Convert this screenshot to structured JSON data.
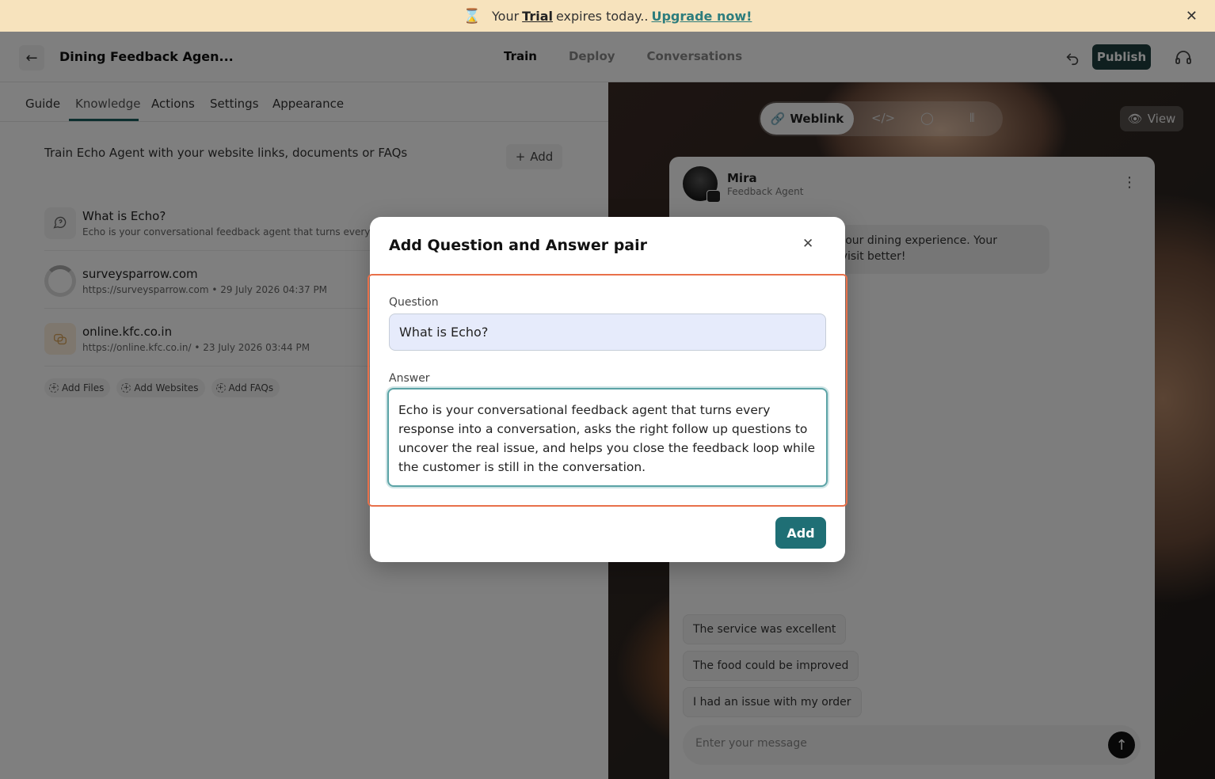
{
  "banner": {
    "prefix": "Your",
    "trial": "Trial",
    "middle": "expires today..",
    "upgrade": "Upgrade now!"
  },
  "topnav": {
    "agent_title": "Dining Feedback Agen...",
    "tabs": [
      "Train",
      "Deploy",
      "Conversations"
    ],
    "active_tab": "Train",
    "publish_label": "Publish"
  },
  "left": {
    "subtabs": [
      "Guide",
      "Knowledge",
      "Actions",
      "Settings",
      "Appearance"
    ],
    "active_subtab": "Knowledge",
    "train_text": "Train Echo Agent with your website links, documents or FAQs",
    "add_label": "Add",
    "items": [
      {
        "title": "What is Echo?",
        "subtitle": "Echo is your conversational feedback agent that turns every res..."
      },
      {
        "title": "surveysparrow.com",
        "subtitle": "https://surveysparrow.com • 29 July 2026 04:37 PM"
      },
      {
        "title": "online.kfc.co.in",
        "subtitle": "https://online.kfc.co.in/ • 23 July 2026 03:44 PM"
      }
    ],
    "chips": [
      "Add Files",
      "Add Websites",
      "Add FAQs"
    ]
  },
  "preview": {
    "weblink_label": "Weblink",
    "view_label": "View",
    "bot_name": "Mira",
    "bot_role": "Feedback Agent",
    "greeting": "t your dining experience. Your\ny visit better!",
    "suggestions": [
      "The service was excellent",
      "The food could be improved",
      "I had an issue with my order"
    ],
    "input_placeholder": "Enter your message"
  },
  "modal": {
    "title": "Add Question and Answer pair",
    "question_label": "Question",
    "question_value": "What is Echo?",
    "answer_label": "Answer",
    "answer_value": "Echo is your conversational feedback agent that turns every response into a conversation, asks the right follow up questions to uncover the real issue, and helps you close the feedback loop while the customer is still in the conversation.",
    "add_label": "Add"
  },
  "colors": {
    "accent": "#1f6f75",
    "publish": "#1f3f3f",
    "highlight": "#e8704a",
    "banner": "#f7e3bd"
  }
}
